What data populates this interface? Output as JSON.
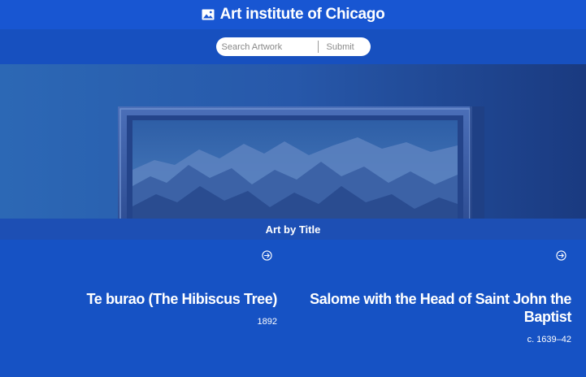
{
  "header": {
    "title": "Art institute of Chicago",
    "logo_icon": "image-icon"
  },
  "search": {
    "placeholder": "Search Artwork",
    "value": "",
    "submit_label": "Submit"
  },
  "hero": {
    "image": "framed-mountain-painting"
  },
  "section": {
    "title": "Art by Title"
  },
  "cards": [
    {
      "title": "Te burao (The Hibiscus Tree)",
      "date": "1892",
      "icon": "arrow-circle-right-icon"
    },
    {
      "title": "Salome with the Head of Saint John the Baptist",
      "date": "c. 1639–42",
      "icon": "arrow-circle-right-icon"
    }
  ],
  "colors": {
    "header_bg": "#1856d2",
    "search_bg": "#1750bf",
    "section_bg": "#1d4fb4",
    "page_bg": "#1652c4",
    "text": "#ffffff"
  }
}
